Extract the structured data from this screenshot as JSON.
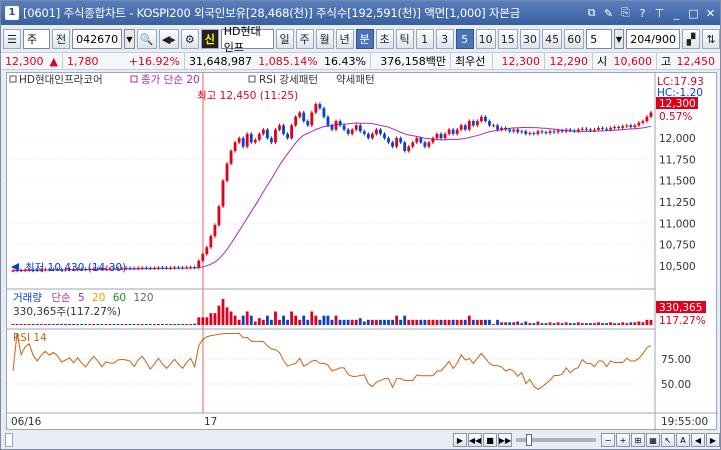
{
  "window": {
    "number": "1",
    "title": "[0601] 주식종합차트 - KOSPI200 외국인보유[28,468(천)] 주식수[192,591(천)] 액면[1,000] 자본금"
  },
  "toolbar": {
    "market_code": "주",
    "prev_label": "전",
    "stock_code": "042670",
    "stock_name": "HD현대인프",
    "period_buttons": [
      "일",
      "주",
      "월",
      "년",
      "분",
      "초",
      "틱"
    ],
    "active_period": "분",
    "interval_buttons": [
      "1",
      "3",
      "5",
      "10",
      "15",
      "30",
      "45",
      "60"
    ],
    "active_interval": "5",
    "interval_value": "5",
    "count_value": "204",
    "count_total": "/900"
  },
  "quote": {
    "price": "12,300",
    "change": "1,780",
    "change_pct": "+16.92%",
    "volume": "31,648,987",
    "volume_ratio": "1,085.14%",
    "turnover": "16.43%",
    "amount": "376,158백만",
    "best_label": "최우선",
    "ask": "12,300",
    "bid": "12,290",
    "open_label": "시",
    "open": "10,600",
    "high_label": "고",
    "high": "12,450"
  },
  "chart_data": [
    {
      "type": "candlestick",
      "legend": [
        "HD현대인프라코어",
        "종가 단순 20",
        "RSI 강세패턴",
        "약세패턴"
      ],
      "y_ticks": [
        "12,000",
        "11,750",
        "11,500",
        "11,250",
        "11,000",
        "10,750",
        "10,500"
      ],
      "ylim": [
        10300,
        12600
      ],
      "lc_label": "LC:17.93",
      "hc_label": "HC:-1.20",
      "current_price": "12,300",
      "current_pct": "0.57%",
      "high_annotation": "최고 12,450 (11:25)",
      "low_annotation": "최저 10,430 (14:30)",
      "x_labels": [
        "06/16",
        "17"
      ],
      "time_label": "19:55:00",
      "closes": [
        10445,
        10450,
        10448,
        10452,
        10455,
        10452,
        10450,
        10455,
        10460,
        10458,
        10462,
        10460,
        10455,
        10458,
        10462,
        10460,
        10465,
        10462,
        10460,
        10465,
        10470,
        10468,
        10465,
        10470,
        10472,
        10470,
        10468,
        10472,
        10475,
        10472,
        10470,
        10475,
        10478,
        10475,
        10472,
        10476,
        10480,
        10478,
        10475,
        10478,
        10482,
        10480,
        10478,
        10482,
        10485,
        10480,
        10560,
        10640,
        10720,
        10850,
        10980,
        11200,
        11500,
        11700,
        11850,
        11950,
        12000,
        11900,
        12050,
        11950,
        11980,
        12050,
        12100,
        12000,
        11950,
        12100,
        12150,
        12050,
        12000,
        12150,
        12250,
        12300,
        12200,
        12150,
        12300,
        12400,
        12350,
        12250,
        12150,
        12100,
        12200,
        12150,
        12100,
        12050,
        12100,
        12150,
        12080,
        12050,
        12000,
        12050,
        12100,
        12050,
        12000,
        11950,
        11900,
        12000,
        11950,
        11850,
        11900,
        11950,
        12000,
        11950,
        11900,
        11950,
        12000,
        12050,
        12000,
        12050,
        12100,
        12050,
        12100,
        12150,
        12100,
        12200,
        12150,
        12200,
        12250,
        12200,
        12150,
        12150,
        12100,
        12120,
        12100,
        12080,
        12100,
        12070,
        12080,
        12050,
        12060,
        12050,
        12080,
        12070,
        12060,
        12080,
        12070,
        12090,
        12080,
        12100,
        12090,
        12080,
        12100,
        12110,
        12100,
        12090,
        12100,
        12120,
        12110,
        12100,
        12120,
        12130,
        12120,
        12140,
        12150,
        12130,
        12150,
        12180,
        12200,
        12250,
        12300
      ]
    },
    {
      "type": "bar",
      "legend": [
        "거래량",
        "단순",
        "5",
        "20",
        "60",
        "120"
      ],
      "volume_text": "330,365주(117.27%)",
      "current_volume": "330,365",
      "current_volume_pct": "117.27%"
    },
    {
      "type": "line",
      "legend": [
        "RSI 14"
      ],
      "y_ticks": [
        "75.00",
        "50.00"
      ],
      "ylim": [
        0,
        100
      ]
    }
  ],
  "colors": {
    "up": "#e0001a",
    "down": "#0a3fd0",
    "ma": "#b02ab0",
    "rsi": "#c86414",
    "title_bar": "#3f66a8"
  }
}
